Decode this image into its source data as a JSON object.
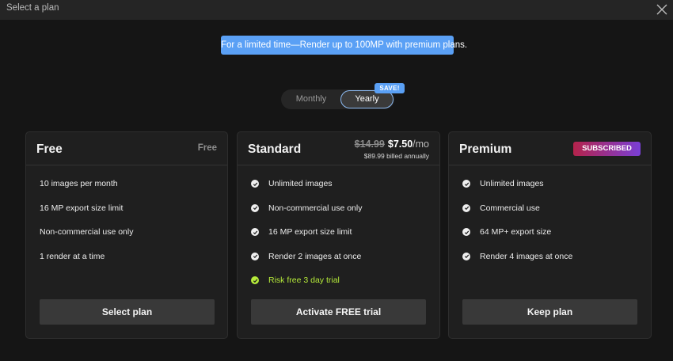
{
  "window": {
    "title": "Select a plan",
    "close_icon": "close-icon"
  },
  "banner": {
    "text": "For a limited time—Render up to 100MP with premium plans."
  },
  "billing_toggle": {
    "monthly_label": "Monthly",
    "yearly_label": "Yearly",
    "selected": "Yearly",
    "save_badge": "SAVE!"
  },
  "plans": {
    "free": {
      "name": "Free",
      "price_label": "Free",
      "features": [
        "10 images per month",
        "16 MP export size limit",
        "Non-commercial use only",
        "1 render at a time"
      ],
      "button_label": "Select plan"
    },
    "standard": {
      "name": "Standard",
      "old_price": "$14.99",
      "new_price": "$7.50",
      "per": "/mo",
      "billed": "$89.99 billed annually",
      "features": [
        "Unlimited images",
        "Non-commercial use only",
        "16 MP export size limit",
        "Render 2 images at once"
      ],
      "trial_feature": "Risk free 3 day trial",
      "button_label": "Activate FREE trial"
    },
    "premium": {
      "name": "Premium",
      "badge": "SUBSCRIBED",
      "features": [
        "Unlimited images",
        "Commercial use",
        "64 MP+ export size",
        "Render 4 images at once"
      ],
      "button_label": "Keep plan"
    }
  },
  "colors": {
    "accent_blue": "#5aa0f5",
    "trial_green": "#b6eb3a",
    "badge_gradient_start": "#b4234b",
    "badge_gradient_end": "#7a3fd6"
  }
}
